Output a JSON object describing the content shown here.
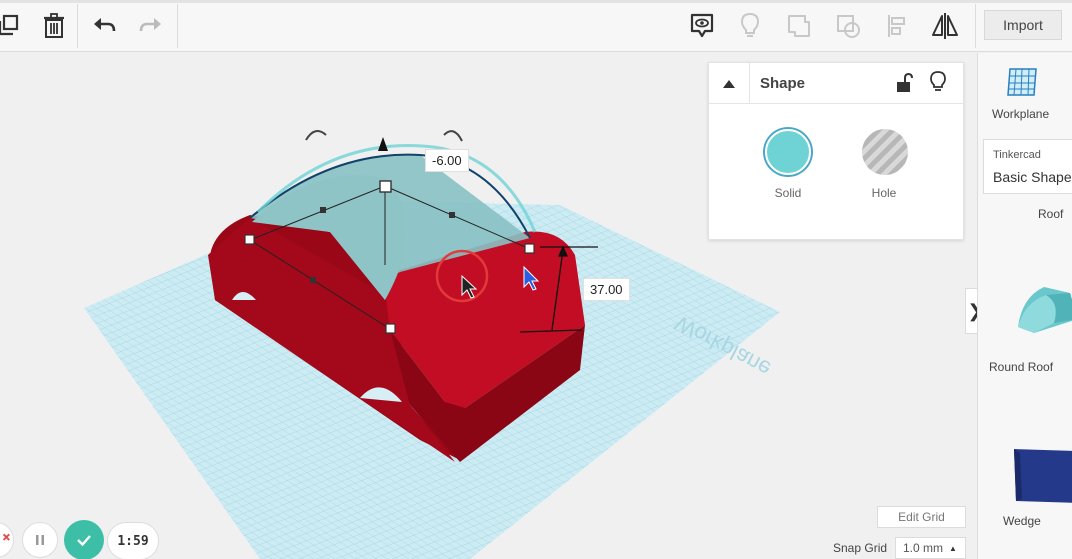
{
  "toolbar": {
    "import_label": "Import",
    "icons": [
      "copy-icon",
      "trash-icon",
      "undo-icon",
      "redo-icon",
      "show-hide-icon",
      "light-bulb-icon",
      "group-icon",
      "ungroup-icon",
      "align-icon",
      "mirror-icon"
    ]
  },
  "viewport": {
    "height_dim": "37.00",
    "elevation_dim": "-6.00",
    "workplane_text": "Workplane",
    "colors": {
      "car_body": "#b0081f",
      "roof": "#7fbcbf",
      "grid": "#bfe6ef"
    }
  },
  "shape_panel": {
    "title": "Shape",
    "solid_label": "Solid",
    "hole_label": "Hole",
    "solid_color": "#6fd3d6"
  },
  "sidebar": {
    "workplane_label": "Workplane",
    "library_small": "Tinkercad",
    "library_name": "Basic Shapes",
    "items": [
      {
        "label": "Roof"
      },
      {
        "label": "Round Roof"
      },
      {
        "label": "Wedge"
      }
    ]
  },
  "grid": {
    "edit_label": "Edit Grid",
    "snap_label": "Snap Grid",
    "snap_value": "1.0 mm"
  },
  "player": {
    "time": "1:59",
    "check_color": "#3cbfa6"
  }
}
